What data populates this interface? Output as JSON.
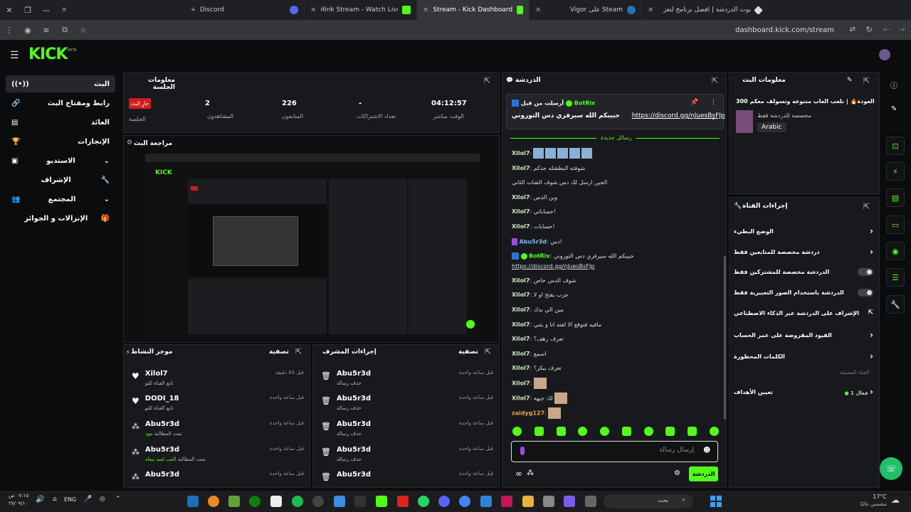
{
  "colors": {
    "accent": "#53fc18",
    "live": "#d11d1d",
    "panel": "#18191c"
  },
  "browser": {
    "tabs": [
      {
        "label": "بوت الدردشة | أفضل برنامج لتعز",
        "active": false
      },
      {
        "label": "Vigor على Steam",
        "active": false
      },
      {
        "label": "Stream - Kick Dashboard",
        "active": true
      },
      {
        "label": "i6nk Stream - Watch Live on",
        "active": false
      },
      {
        "label": "Discord",
        "active": false
      }
    ],
    "url": "dashboard.kick.com/stream"
  },
  "app": {
    "logo": "KICK",
    "beta": "BETA"
  },
  "sidebar": {
    "items": [
      {
        "label": "البث",
        "icon": "live-icon"
      },
      {
        "label": "رابط ومفتاح البث",
        "icon": "link-icon"
      },
      {
        "label": "العائد",
        "icon": "revenue-icon"
      },
      {
        "label": "الإنجازات",
        "icon": "trophy-icon"
      },
      {
        "label": "الاستديو",
        "icon": "studio-icon"
      },
      {
        "label": "الإشراف",
        "icon": "moderation-icon"
      },
      {
        "label": "المجتمع",
        "icon": "community-icon"
      },
      {
        "label": "الإنزالات و الجوائز",
        "icon": "drops-icon"
      }
    ]
  },
  "session": {
    "title": "معلومات الجلسة",
    "live_badge": "جارٍ البث",
    "session_label": "الجلسة",
    "viewers_value": "2",
    "viewers_label": "المشاهدون",
    "followers_value": "226",
    "followers_label": "المتابعون",
    "subs_value": "-",
    "subs_label": "تعداد الاشتراكات",
    "uptime_value": "04:12:57",
    "uptime_label": "الوقت مباشر"
  },
  "preview": {
    "title": "مراجعة البث"
  },
  "activity": {
    "title": "موجز النشاط",
    "filter": "تصفية",
    "items": [
      {
        "user": "Xilol7",
        "action": "تابع القناة للتو",
        "ago": "قبل 43 دقيقة"
      },
      {
        "user": "DODI_18",
        "action": "تابع القناة للتو",
        "ago": "قبل ساعة واحدة"
      },
      {
        "user": "Abu5r3d",
        "action_prefix": "تمت المطالبة ",
        "action_green": "مود",
        "ago": "قبل ساعة واحدة"
      },
      {
        "user": "Abu5r3d",
        "action_prefix": "تمت المطالبة ",
        "action_green": "العب لعبه تبغاه",
        "ago": "قبل ساعة واحدة"
      },
      {
        "user": "Abu5r3d",
        "action_prefix": "",
        "action_green": "",
        "ago": "قبل ساعة واحدة"
      }
    ]
  },
  "modactions": {
    "title": "إجراءات المشرف",
    "filter": "تصفية",
    "items": [
      {
        "user": "Abu5r3d",
        "action": "حذف رسالة",
        "ago": "قبل ساعة واحدة"
      },
      {
        "user": "Abu5r3d",
        "action": "حذف رسالة",
        "ago": "قبل ساعة واحدة"
      },
      {
        "user": "Abu5r3d",
        "action": "حذف رسالة",
        "ago": "قبل ساعة واحدة"
      },
      {
        "user": "Abu5r3d",
        "action": "حذف رسالة",
        "ago": "قبل ساعة واحدة"
      },
      {
        "user": "Abu5r3d",
        "action": "",
        "ago": "قبل ساعة واحدة"
      }
    ]
  },
  "chat": {
    "title": "الدردشة",
    "pinned_by": "BotRix",
    "pinned_prefix": "أرسلت من قبل",
    "pinned_text": "حبيبكم الله سيرفري دس التوروني",
    "pinned_link": "https://discord.gg/nJuesBsFJp",
    "new_messages": "رسائل جديدة",
    "messages": [
      {
        "user": "Xilol7",
        "text": "",
        "emote": "blocks"
      },
      {
        "user": "Xilol7",
        "text": "شوفته البطشله جدكم"
      },
      {
        "user": "",
        "text": "الحين ارسل لك دس شوف الشات الثاني"
      },
      {
        "user": "Xilol7",
        "text": "وين الدس"
      },
      {
        "user": "Xilol7",
        "text": "حساباتي!"
      },
      {
        "user": "Xilol7",
        "text": "حسابات!"
      },
      {
        "user": "Abu5r3d",
        "text": "دس!"
      },
      {
        "user": "BotRix",
        "text": "حبيبكم الله سيرفري دس التوروني"
      },
      {
        "user": "",
        "text": "https://discord.gg/nJuesBsFJp"
      },
      {
        "user": "Xilol7",
        "text": "شوف الدس خاص"
      },
      {
        "user": "Xilol7",
        "text": "جرب يفتح او لا"
      },
      {
        "user": "Xilol7",
        "text": "مين الي بدك"
      },
      {
        "user": "Xilol7",
        "text": "مافيه فتوقع الا لقته انا و بثني"
      },
      {
        "user": "Xilol7",
        "text": "تعرف رهف؟"
      },
      {
        "user": "Xilol7",
        "text": "اسمع"
      },
      {
        "user": "Xilol7",
        "text": "تعرف بيكر؟"
      },
      {
        "user": "Xilol7",
        "text": "",
        "emote": "cat"
      },
      {
        "user": "Xilol7",
        "text": "لك جيهه",
        "emote": "cat"
      },
      {
        "user": "zaidyg127",
        "text": "",
        "emote": "cat"
      }
    ],
    "input_placeholder": "إرسال رسالة",
    "send_label": "الدردشة"
  },
  "streaminfo": {
    "title": "معلومات البث",
    "stream_title": "بث العودة🔥 |  نلعب العاب متنوعه وتسولف معكم 300|",
    "category": "مخصصة للدردشة فقط",
    "language": "Arabic"
  },
  "channel_actions": {
    "title": "إجراءات القناة",
    "rows": [
      {
        "label": "الوضع البطيء",
        "control": "chevron"
      },
      {
        "label": "دردشة مخصصة للمتابعين فقط",
        "control": "chevron"
      },
      {
        "label": "الدردشة مخصصة للمشتركين فقط",
        "control": "toggle"
      },
      {
        "label": "الدردشة باستخدام الصور التعبيرية فقط",
        "control": "toggle"
      },
      {
        "label": "الإشراف على الدردشة عبر الذكاء الاصطناعي",
        "control": "external"
      },
      {
        "label": "القيود المفروضة على عمر الحساب",
        "control": "chevron"
      },
      {
        "label": "الكلمات المحظورة",
        "control": "chevron"
      }
    ],
    "custom_heading": "القناة المضيفة",
    "goals_label": "تعيين الأهداف",
    "goals_status": "فعال 1"
  },
  "taskbar": {
    "weather_temp": "17°C",
    "weather_text": "مشمس غالبًا",
    "search_placeholder": "بحث",
    "lang": "ENG",
    "time": "٠٧:١٥ ص",
    "date": "٢٧/٠٩/١٠"
  }
}
